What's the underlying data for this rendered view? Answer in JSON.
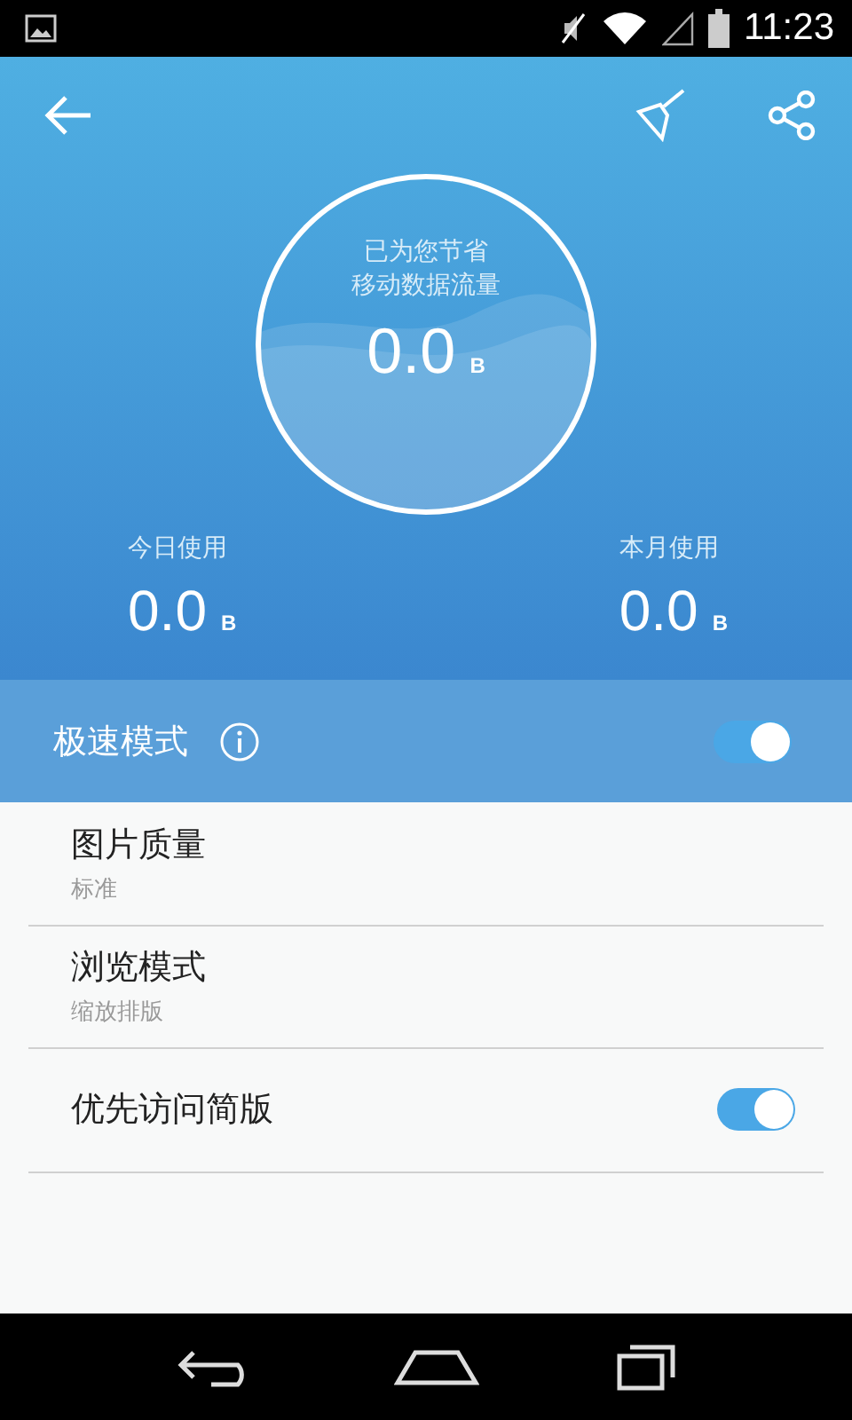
{
  "status_bar": {
    "time": "11:23"
  },
  "savings": {
    "caption_lines": [
      "已为您节省",
      "移动数据流量"
    ],
    "value": "0.0",
    "unit": "B"
  },
  "usage": [
    {
      "label": "今日使用",
      "value": "0.0",
      "unit": "B"
    },
    {
      "label": "本月使用",
      "value": "0.0",
      "unit": "B"
    }
  ],
  "fast_mode": {
    "label": "极速模式",
    "on": true
  },
  "settings": [
    {
      "kind": "value",
      "title": "图片质量",
      "value": "标准"
    },
    {
      "kind": "value",
      "title": "浏览模式",
      "value": "缩放排版"
    },
    {
      "kind": "toggle",
      "title": "优先访问简版",
      "on": true
    }
  ]
}
